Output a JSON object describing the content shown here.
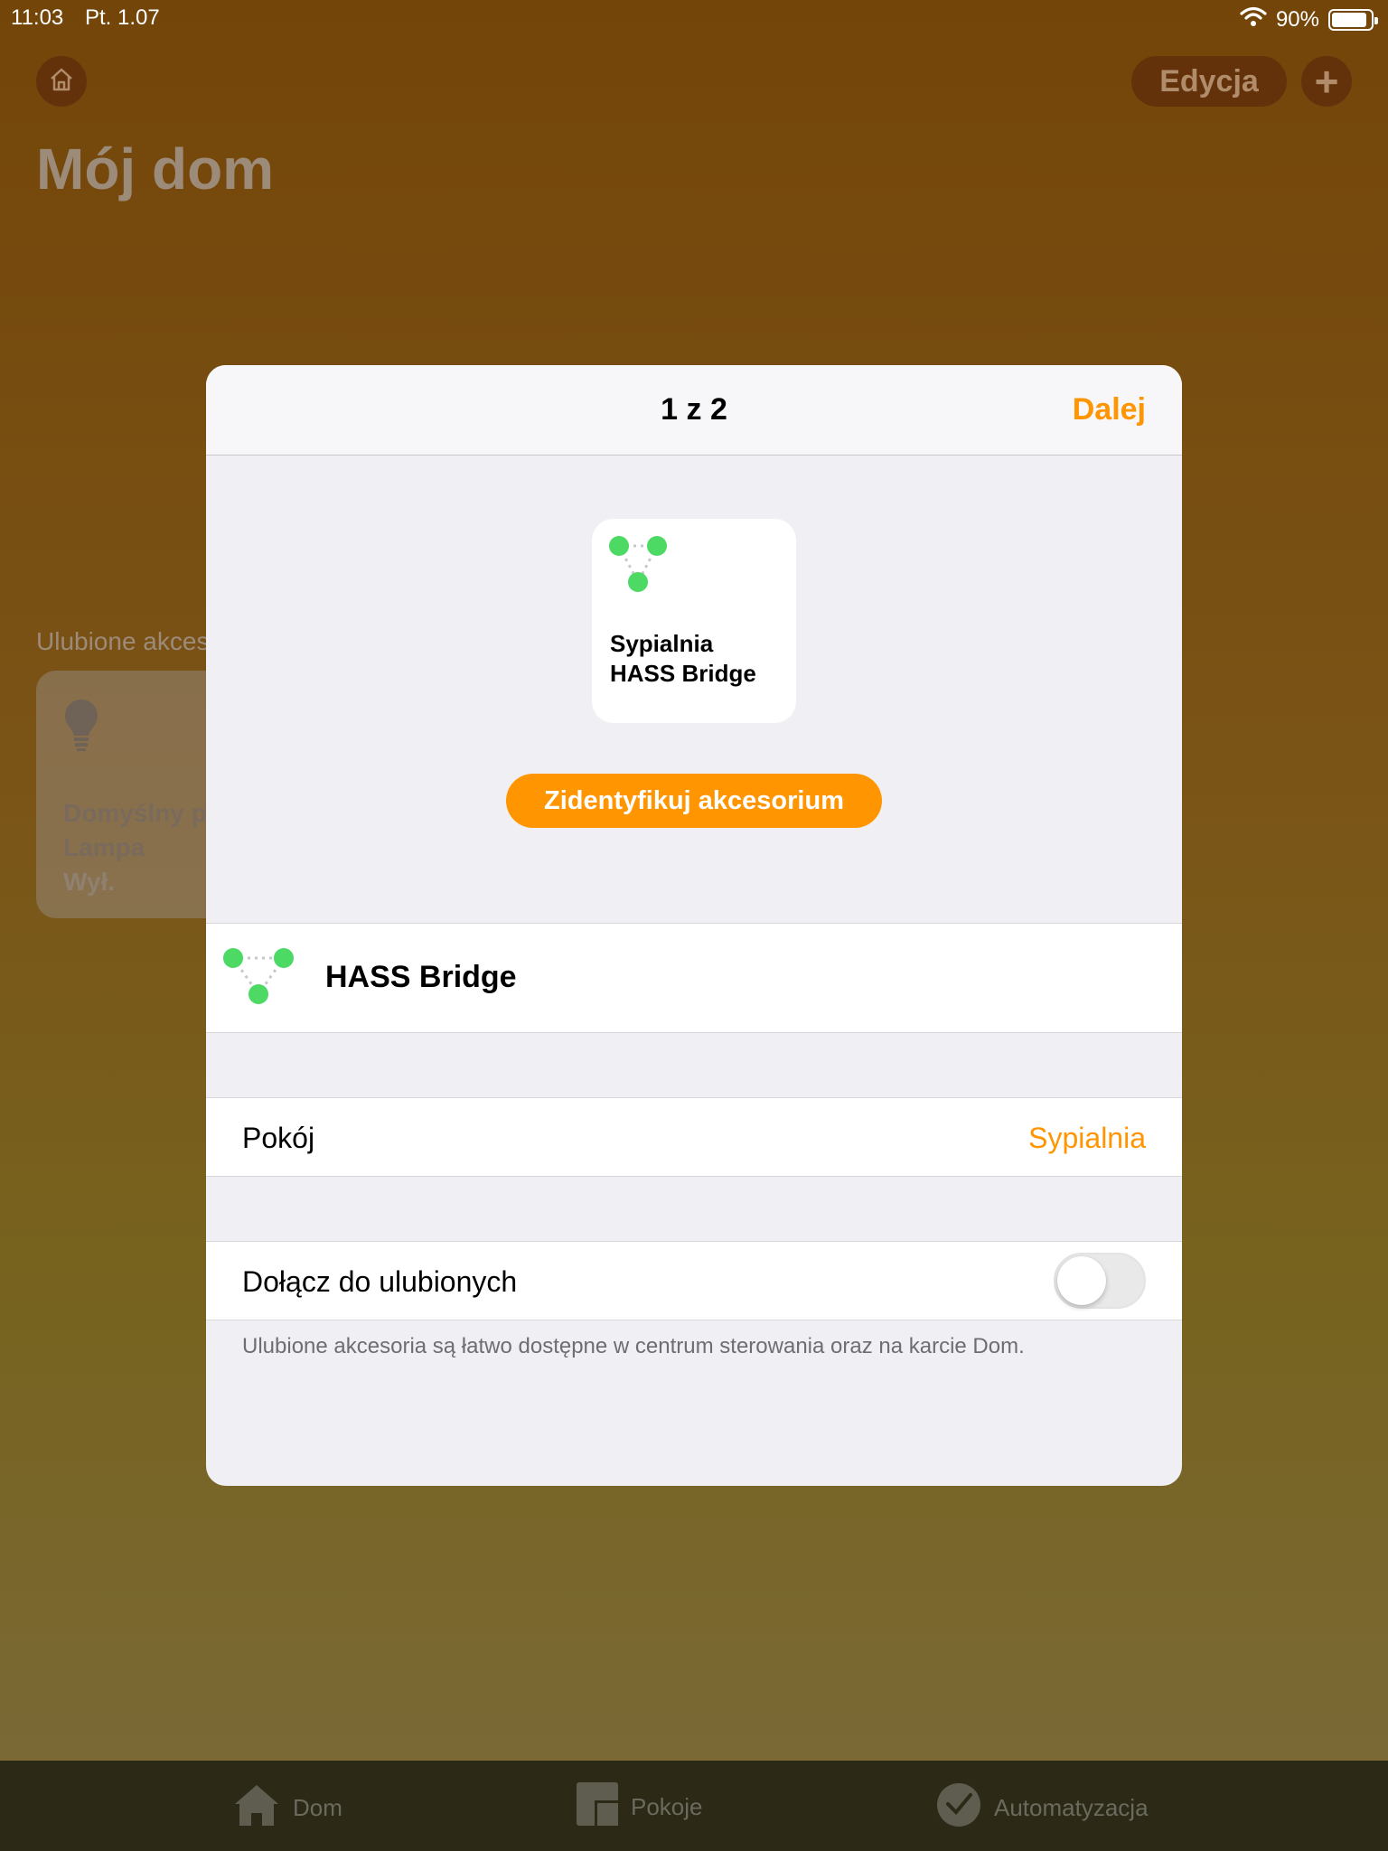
{
  "status_bar": {
    "time": "11:03",
    "date": "Pt. 1.07",
    "battery": "90%",
    "battery_level": 0.9
  },
  "background": {
    "edit_label": "Edycja",
    "add_label": "+",
    "title": "Mój dom",
    "favorites_label": "Ulubione akcesoria",
    "tile": {
      "name_line1": "Domyślny pokój",
      "name_line2": "Lampa",
      "status": "Wył."
    }
  },
  "tab_bar": {
    "items": [
      {
        "label": "Dom"
      },
      {
        "label": "Pokoje"
      },
      {
        "label": "Automatyzacja"
      }
    ]
  },
  "modal": {
    "title": "1 z 2",
    "next_label": "Dalej",
    "accessory_card": {
      "room": "Sypialnia",
      "name": "HASS Bridge"
    },
    "identify_label": "Zidentyfikuj akcesorium",
    "accessory_name": "HASS Bridge",
    "room_row": {
      "label": "Pokój",
      "value": "Sypialnia"
    },
    "favorite_row": {
      "label": "Dołącz do ulubionych",
      "enabled": false
    },
    "footnote": "Ulubione akcesoria są łatwo dostępne w centrum sterowania oraz na karcie Dom."
  },
  "colors": {
    "accent": "#ff9500",
    "bridge_green": "#4cd964"
  }
}
